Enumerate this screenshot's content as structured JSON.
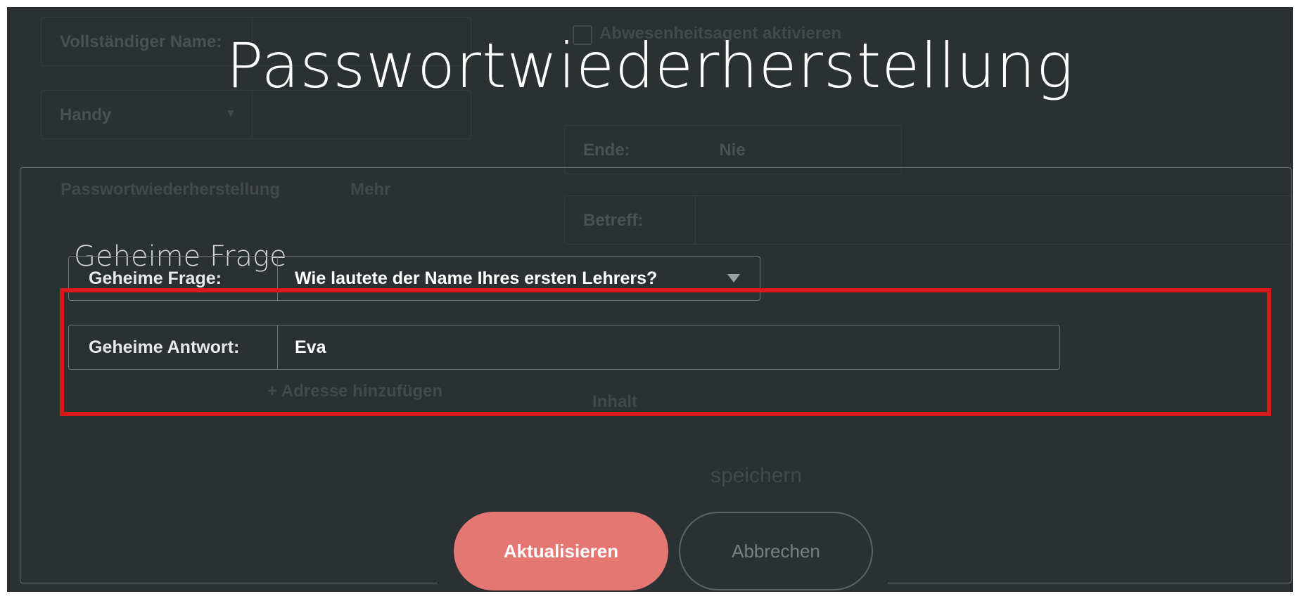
{
  "background": {
    "full_name_label": "Vollständiger Name:",
    "phone_type": "Handy",
    "tab_password": "Passwortwiederherstellung",
    "tab_more": "Mehr",
    "out_of_office_label": "Abwesenheitsagent aktivieren",
    "end_label": "Ende:",
    "end_value": "Nie",
    "subject_label": "Betreff:",
    "add_link": "+ Adresse hinzufügen",
    "body_text": "Inhalt",
    "save_text": "speichern"
  },
  "dialog": {
    "title": "Passwortwiederherstellung",
    "section_title": "Geheime Frage",
    "question_label": "Geheime Frage:",
    "question_value": "Wie lautete der Name Ihres ersten Lehrers?",
    "answer_label": "Geheime Antwort:",
    "answer_value": "Eva",
    "update_button": "Aktualisieren",
    "cancel_button": "Abbrechen"
  },
  "colors": {
    "background": "#2b3033",
    "highlight": "#d91a1a",
    "primary_button": "#e57773"
  }
}
